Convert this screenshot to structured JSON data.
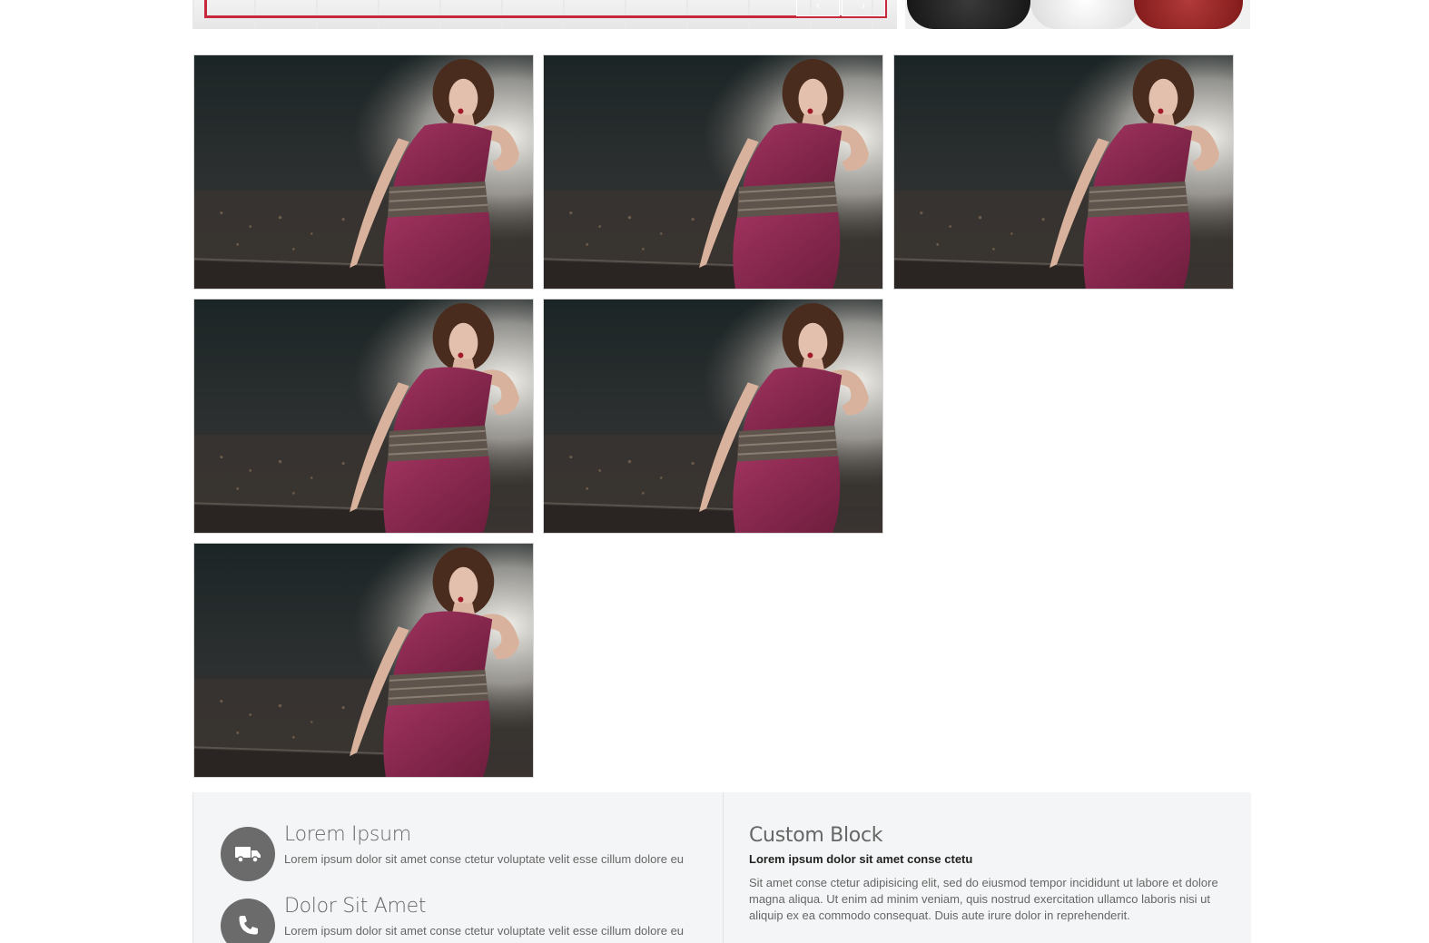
{
  "banner": {
    "prev_icon": "chevron-left-icon",
    "next_icon": "chevron-right-icon",
    "accent_color": "#c8283c"
  },
  "gallery": {
    "tile_count": 6,
    "image_subject": "woman in magenta dress on rooftop at night"
  },
  "features": [
    {
      "icon": "truck-icon",
      "title": "Lorem Ipsum",
      "text": "Lorem ipsum dolor sit amet conse ctetur voluptate velit esse cillum dolore eu"
    },
    {
      "icon": "phone-icon",
      "title": "Dolor Sit Amet",
      "text": "Lorem ipsum dolor sit amet conse ctetur voluptate velit esse cillum dolore eu"
    }
  ],
  "custom_block": {
    "title": "Custom Block",
    "subtitle": "Lorem ipsum dolor sit amet conse ctetu",
    "body": "Sit amet conse ctetur adipisicing elit, sed do eiusmod tempor incididunt ut labore et dolore magna aliqua. Ut enim ad minim veniam, quis nostrud exercitation ullamco laboris nisi ut aliquip ex ea commodo consequat. Duis aute irure dolor in reprehenderit."
  }
}
